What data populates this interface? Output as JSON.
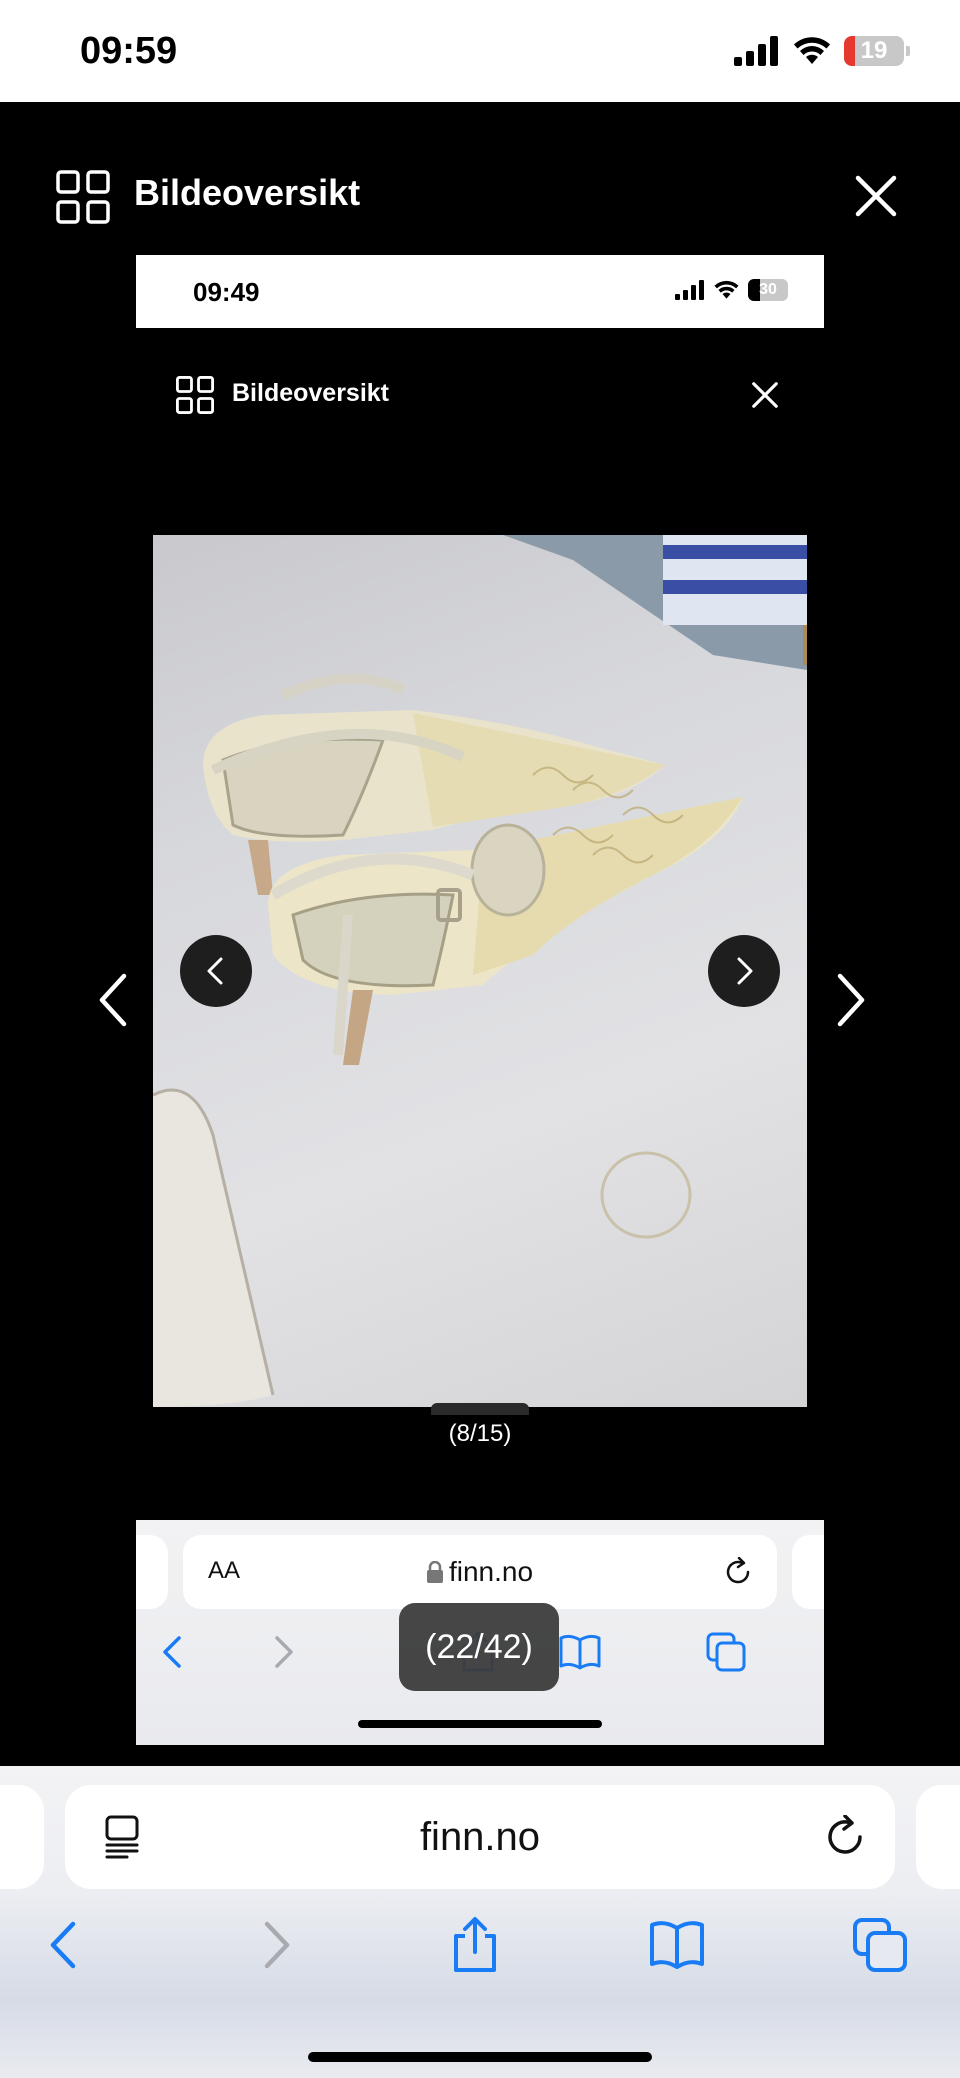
{
  "status_bar": {
    "time": "09:59",
    "battery": "19"
  },
  "viewer": {
    "title": "Bildeoversikt"
  },
  "inner": {
    "status_bar": {
      "time": "09:49",
      "battery": "30"
    },
    "viewer_title": "Bildeoversikt",
    "image_counter": "(8/15)",
    "browser": {
      "aa_label": "AA",
      "domain": "finn.no"
    },
    "toast": "(22/42)"
  },
  "browser": {
    "domain": "finn.no"
  },
  "colors": {
    "accent": "#1a7cf5",
    "battery_low": "#e5392f"
  }
}
